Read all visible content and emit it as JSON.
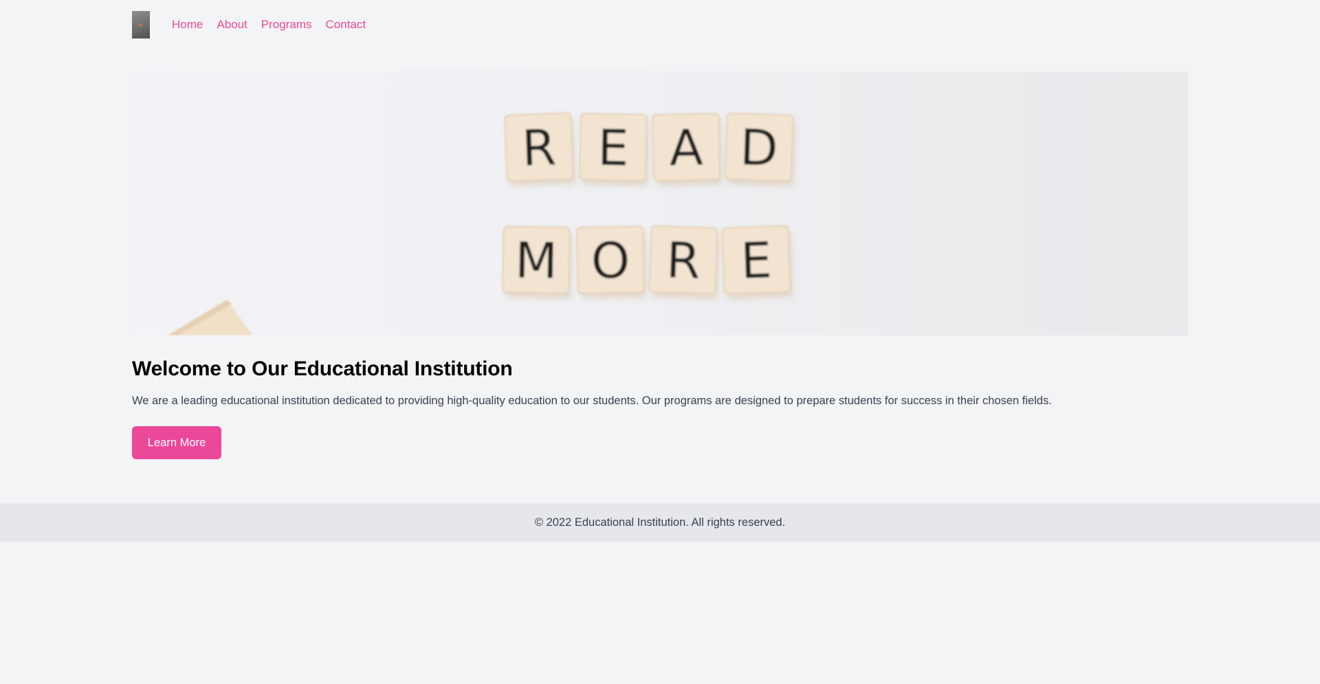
{
  "nav": {
    "logo": "institution-logo",
    "links": [
      "Home",
      "About",
      "Programs",
      "Contact"
    ]
  },
  "hero": {
    "image": "scrabble-tiles-read-more",
    "tiles_row1": [
      "R",
      "E",
      "A",
      "D"
    ],
    "tiles_row2": [
      "M",
      "O",
      "R",
      "E"
    ]
  },
  "main": {
    "title": "Welcome to Our Educational Institution",
    "description": "We are a leading educational institution dedicated to providing high-quality education to our students. Our programs are designed to prepare students for success in their chosen fields.",
    "cta_label": "Learn More"
  },
  "footer": {
    "text": "© 2022 Educational Institution. All rights reserved."
  },
  "colors": {
    "accent": "#ec4899",
    "page_bg": "#f3f4f6",
    "footer_bg": "#e5e7eb"
  }
}
